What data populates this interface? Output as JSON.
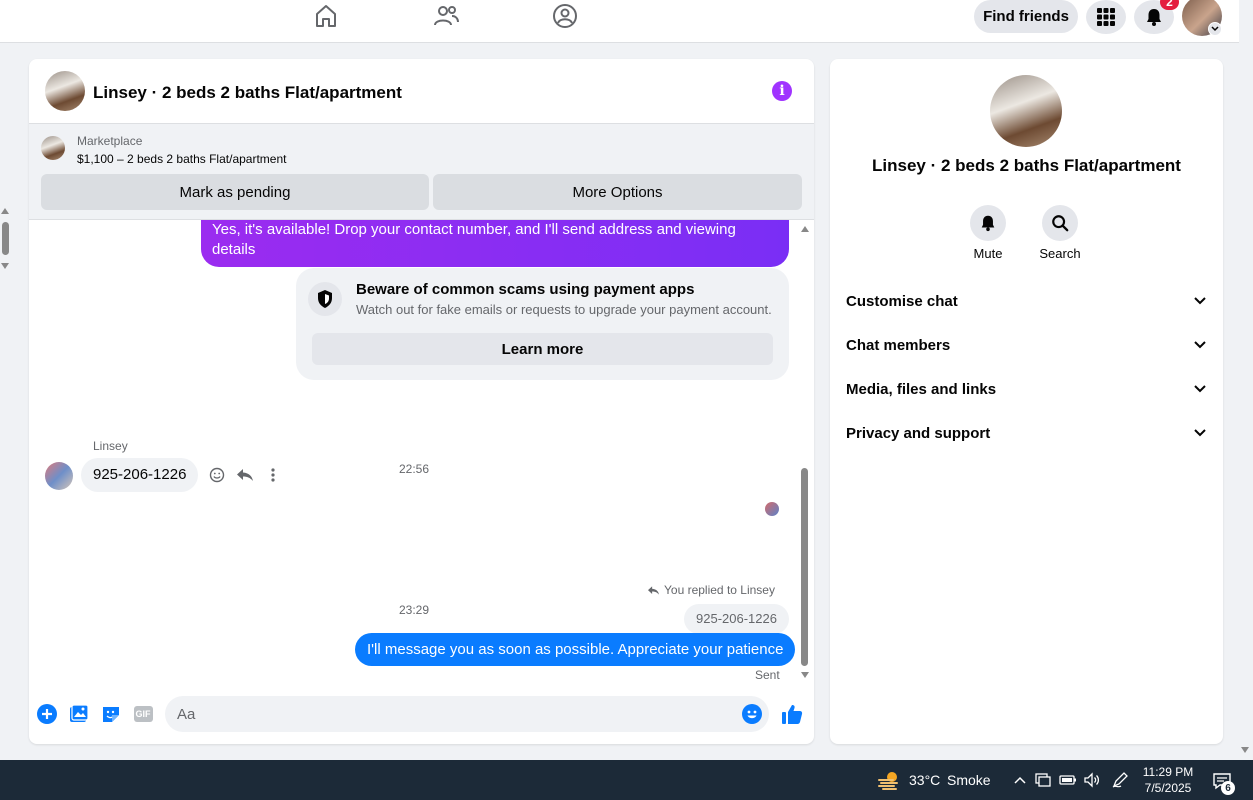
{
  "topnav": {
    "find_friends_label": "Find friends",
    "notification_count": "2"
  },
  "chat": {
    "title": "Linsey · 2 beds 2 baths Flat/apartment",
    "marketplace": {
      "label": "Marketplace",
      "listing": "$1,100 – 2 beds 2 baths Flat/apartment",
      "mark_pending_label": "Mark as pending",
      "more_options_label": "More Options"
    },
    "messages": {
      "outgoing_first": "Yes, it's available! Drop your contact number, and I'll send address and viewing details",
      "scam_notice": {
        "title": "Beware of common scams using payment apps",
        "body": "Watch out for fake emails or requests to upgrade your payment account.",
        "learn_more_label": "Learn more"
      },
      "timestamp_1": "22:56",
      "sender_name": "Linsey",
      "incoming_text": "925-206-1226",
      "timestamp_2": "23:29",
      "replied_label": "You replied to Linsey",
      "quoted_text": "925-206-1226",
      "outgoing_last": "I'll message you as soon as possible. Appreciate your patience",
      "status": "Sent"
    },
    "composer": {
      "placeholder": "Aa"
    }
  },
  "info_panel": {
    "title": "Linsey · 2 beds 2 baths Flat/apartment",
    "actions": [
      {
        "label": "Mute",
        "icon": "bell-icon"
      },
      {
        "label": "Search",
        "icon": "search-icon"
      }
    ],
    "sections": [
      {
        "label": "Customise chat"
      },
      {
        "label": "Chat members"
      },
      {
        "label": "Media, files and links"
      },
      {
        "label": "Privacy and support"
      }
    ]
  },
  "taskbar": {
    "weather_temp": "33°C",
    "weather_condition": "Smoke",
    "time": "11:29 PM",
    "date": "7/5/2025",
    "notification_count": "6"
  },
  "colors": {
    "accent_purple": "#a033ff",
    "messenger_blue": "#0a7cff",
    "badge_red": "#e41e3f",
    "taskbar_bg": "#1c2a38"
  }
}
